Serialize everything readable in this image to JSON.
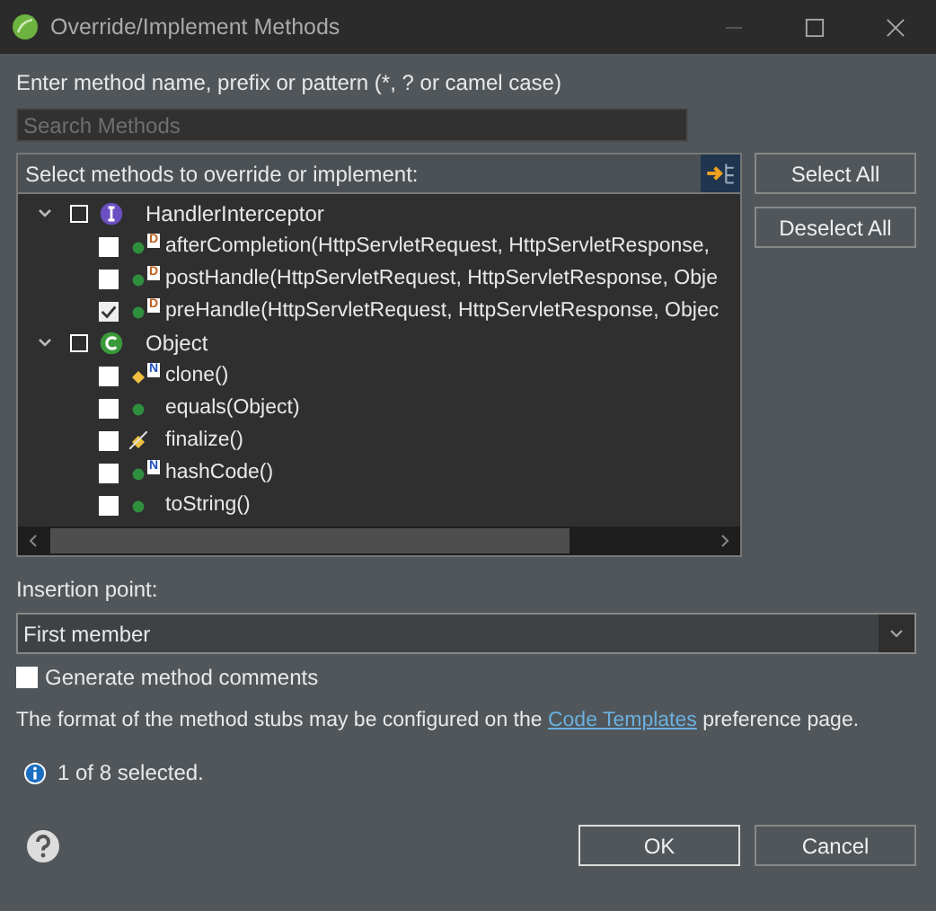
{
  "window": {
    "title": "Override/Implement Methods"
  },
  "filter": {
    "label": "Enter method name, prefix or pattern (*, ? or camel case)",
    "placeholder": "Search Methods"
  },
  "tree": {
    "header": "Select methods to override or implement:",
    "groups": [
      {
        "name": "HandlerInterceptor",
        "kind": "interface",
        "expanded": true,
        "checked": false,
        "children": [
          {
            "name": "afterCompletion(HttpServletRequest, HttpServletResponse,",
            "kind": "public",
            "overlay": "D",
            "checked": false
          },
          {
            "name": "postHandle(HttpServletRequest, HttpServletResponse, Obje",
            "kind": "public",
            "overlay": "D",
            "checked": false
          },
          {
            "name": "preHandle(HttpServletRequest, HttpServletResponse, Objec",
            "kind": "public",
            "overlay": "D",
            "checked": true
          }
        ]
      },
      {
        "name": "Object",
        "kind": "class",
        "expanded": true,
        "checked": false,
        "children": [
          {
            "name": "clone()",
            "kind": "protected",
            "overlay": "N",
            "checked": false
          },
          {
            "name": "equals(Object)",
            "kind": "public",
            "checked": false
          },
          {
            "name": "finalize()",
            "kind": "deprecated",
            "checked": false
          },
          {
            "name": "hashCode()",
            "kind": "public",
            "overlay": "N",
            "checked": false
          },
          {
            "name": "toString()",
            "kind": "public",
            "checked": false
          }
        ]
      }
    ]
  },
  "side_buttons": [
    "Select All",
    "Deselect All"
  ],
  "insertion": {
    "label": "Insertion point:",
    "value": "First member"
  },
  "generate_comments": {
    "label": "Generate method comments",
    "checked": false
  },
  "note": {
    "before": "The format of the method stubs may be configured on the ",
    "link": "Code Templates",
    "after": " preference page."
  },
  "status": "1 of 8 selected.",
  "buttons": [
    "OK",
    "Cancel"
  ]
}
